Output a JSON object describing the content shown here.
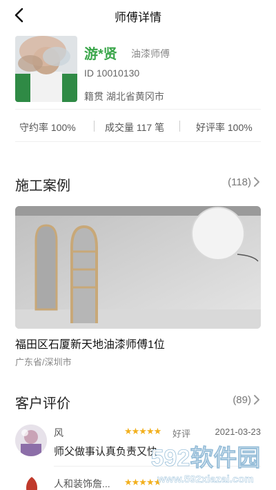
{
  "nav": {
    "title": "师傅详情"
  },
  "profile": {
    "name": "游*贤",
    "role": "油漆师傅",
    "id_text": "ID 10010130",
    "origin": "籍贯 湖北省黄冈市"
  },
  "stats": {
    "keep_rate": "守约率 100%",
    "deals": "成交量 117 笔",
    "good_rate": "好评率 100%"
  },
  "cases": {
    "title": "施工案例",
    "count": "(118)",
    "items": [
      {
        "title": "福田区石厦新天地油漆师傅1位",
        "location": "广东省/深圳市"
      }
    ]
  },
  "reviews": {
    "title": "客户评价",
    "count": "(89)",
    "items": [
      {
        "name": "风",
        "stars": "★★★★★",
        "grade": "好评",
        "date": "2021-03-23",
        "text": "师父做事认真负责又快"
      },
      {
        "name": "人和装饰詹...",
        "stars": "★★★★★",
        "grade": "",
        "date": "",
        "text": ""
      }
    ]
  },
  "watermark": {
    "brand": "592软件园",
    "url": "www.592xiazai.com"
  },
  "colors": {
    "accent_green": "#3aa64a",
    "star": "#f2b01e",
    "watermark": "#ffffff"
  }
}
